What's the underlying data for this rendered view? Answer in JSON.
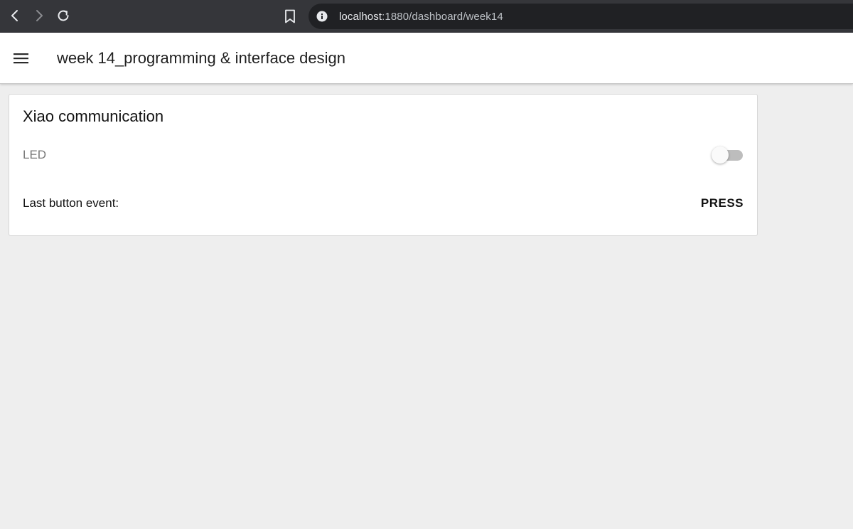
{
  "browser": {
    "url_host": "localhost",
    "url_rest": ":1880/dashboard/week14",
    "icons": {
      "back": "back-arrow-icon",
      "forward": "forward-arrow-icon",
      "reload": "reload-icon",
      "bookmark": "bookmark-icon",
      "site_info": "info-icon"
    }
  },
  "toolbar": {
    "title": "week 14_programming & interface design",
    "menu_icon": "hamburger-menu-icon"
  },
  "card": {
    "title": "Xiao communication",
    "switch": {
      "label": "LED",
      "state": "off"
    },
    "text_widget": {
      "label": "Last button event:",
      "value": "PRESS"
    }
  },
  "colors": {
    "browser_chrome": "#35363a",
    "address_bar": "#202124",
    "page_background": "#eeeeee",
    "card_background": "#ffffff",
    "toggle_track_off": "#bdbdbd"
  }
}
